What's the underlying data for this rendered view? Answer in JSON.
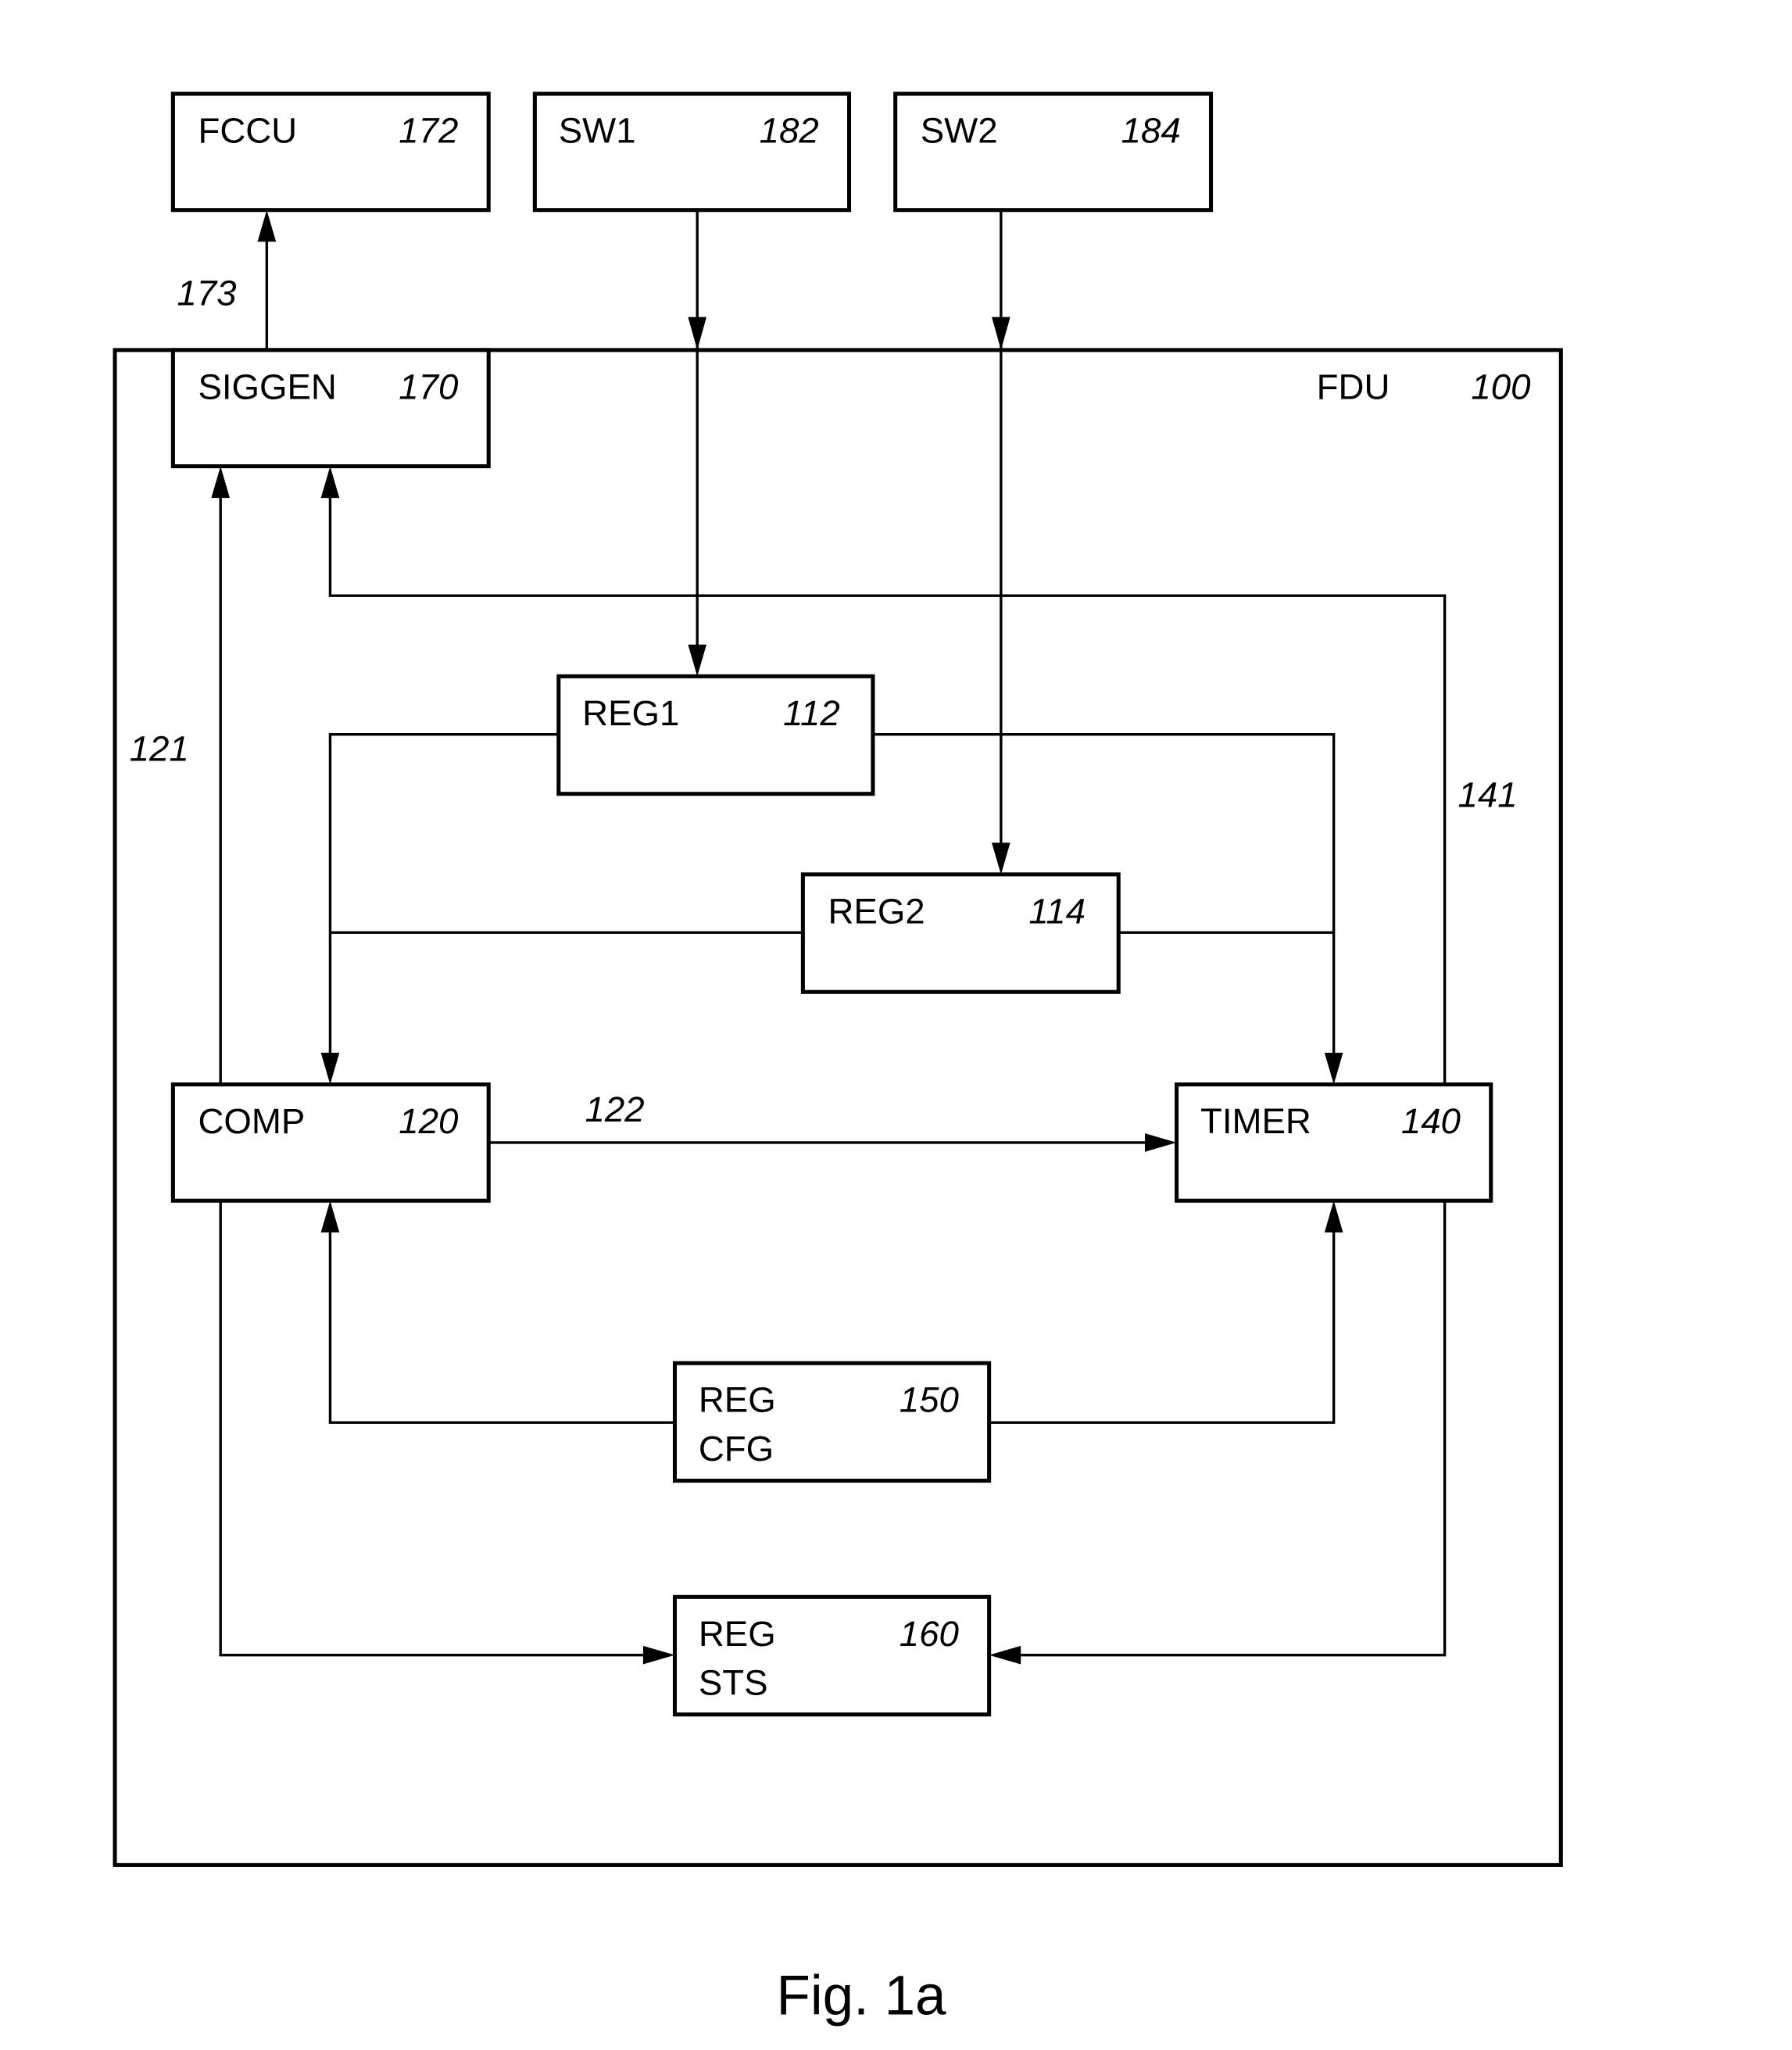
{
  "figure": {
    "caption": "Fig. 1a"
  },
  "container": {
    "name": "FDU",
    "ref": "100"
  },
  "blocks": {
    "fccu": {
      "line1": "FCCU",
      "line2": "",
      "ref": "172"
    },
    "sw1": {
      "line1": "SW1",
      "line2": "",
      "ref": "182"
    },
    "sw2": {
      "line1": "SW2",
      "line2": "",
      "ref": "184"
    },
    "siggen": {
      "line1": "SIGGEN",
      "line2": "",
      "ref": "170"
    },
    "reg1": {
      "line1": "REG1",
      "line2": "",
      "ref": "112"
    },
    "reg2": {
      "line1": "REG2",
      "line2": "",
      "ref": "114"
    },
    "comp": {
      "line1": "COMP",
      "line2": "",
      "ref": "120"
    },
    "timer": {
      "line1": "TIMER",
      "line2": "",
      "ref": "140"
    },
    "regcfg": {
      "line1": "REG",
      "line2": "CFG",
      "ref": "150"
    },
    "regsts": {
      "line1": "REG",
      "line2": "STS",
      "ref": "160"
    }
  },
  "signals": {
    "s173": "173",
    "s121": "121",
    "s122": "122",
    "s141": "141"
  },
  "connections": [
    {
      "from": "SIGGEN",
      "to": "FCCU",
      "label": "173"
    },
    {
      "from": "SW1",
      "to": "REG1"
    },
    {
      "from": "SW2",
      "to": "REG2"
    },
    {
      "from": "COMP",
      "to": "SIGGEN",
      "label": "121"
    },
    {
      "from": "TIMER",
      "to": "SIGGEN",
      "label": "141"
    },
    {
      "from": "REG1",
      "to": "COMP"
    },
    {
      "from": "REG1",
      "to": "TIMER"
    },
    {
      "from": "REG2",
      "to": "COMP"
    },
    {
      "from": "REG2",
      "to": "TIMER"
    },
    {
      "from": "COMP",
      "to": "TIMER",
      "label": "122"
    },
    {
      "from": "REG CFG",
      "to": "COMP"
    },
    {
      "from": "REG CFG",
      "to": "TIMER"
    },
    {
      "from": "COMP",
      "to": "REG STS"
    },
    {
      "from": "TIMER",
      "to": "REG STS"
    }
  ]
}
